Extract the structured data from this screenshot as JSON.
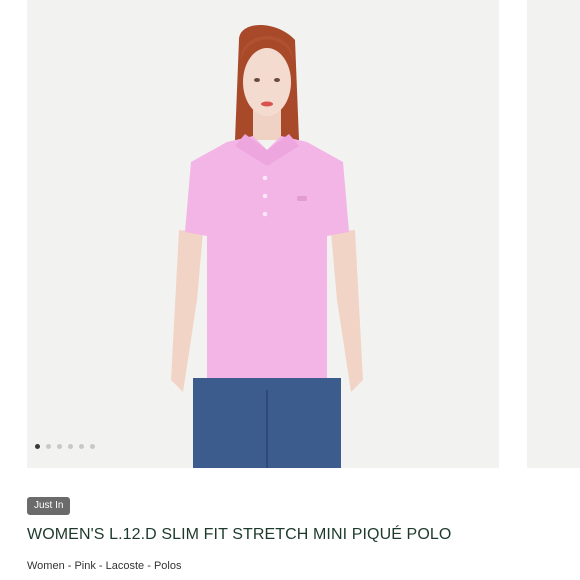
{
  "product": {
    "badge": "Just In",
    "title": "WOMEN'S L.12.D SLIM FIT STRETCH MINI PIQUÉ POLO",
    "breadcrumb": "Women - Pink - Lacoste - Polos"
  },
  "gallery": {
    "image_count": 6,
    "active_index": 0
  },
  "colors": {
    "polo": "#f3b4e6",
    "jeans": "#3d5c8e",
    "hair": "#a84a2a",
    "background": "#f2f2f0",
    "title_text": "#1d3a2c"
  }
}
